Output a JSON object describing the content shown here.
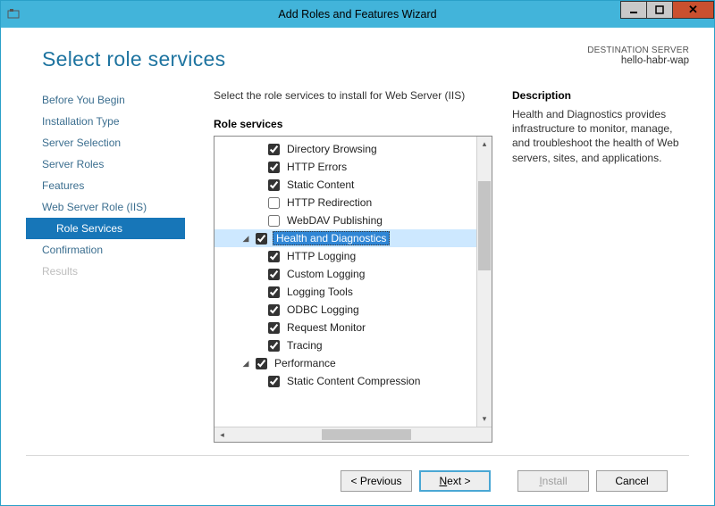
{
  "titlebar": {
    "title": "Add Roles and Features Wizard"
  },
  "page": {
    "heading": "Select role services",
    "destination_label": "DESTINATION SERVER",
    "destination_host": "hello-habr-wap",
    "instruction": "Select the role services to install for Web Server (IIS)",
    "group_label": "Role services"
  },
  "nav": {
    "items": [
      {
        "label": "Before You Begin"
      },
      {
        "label": "Installation Type"
      },
      {
        "label": "Server Selection"
      },
      {
        "label": "Server Roles"
      },
      {
        "label": "Features"
      },
      {
        "label": "Web Server Role (IIS)"
      },
      {
        "label": "Role Services",
        "sub": true,
        "active": true
      },
      {
        "label": "Confirmation"
      },
      {
        "label": "Results",
        "disabled": true
      }
    ]
  },
  "tree": [
    {
      "level": 2,
      "checked": true,
      "label": "Directory Browsing"
    },
    {
      "level": 2,
      "checked": true,
      "label": "HTTP Errors"
    },
    {
      "level": 2,
      "checked": true,
      "label": "Static Content"
    },
    {
      "level": 2,
      "checked": false,
      "label": "HTTP Redirection"
    },
    {
      "level": 2,
      "checked": false,
      "label": "WebDAV Publishing"
    },
    {
      "level": 1,
      "checked": true,
      "label": "Health and Diagnostics",
      "expanded": true,
      "selected": true
    },
    {
      "level": 2,
      "checked": true,
      "label": "HTTP Logging"
    },
    {
      "level": 2,
      "checked": true,
      "label": "Custom Logging"
    },
    {
      "level": 2,
      "checked": true,
      "label": "Logging Tools"
    },
    {
      "level": 2,
      "checked": true,
      "label": "ODBC Logging"
    },
    {
      "level": 2,
      "checked": true,
      "label": "Request Monitor"
    },
    {
      "level": 2,
      "checked": true,
      "label": "Tracing"
    },
    {
      "level": 1,
      "checked": true,
      "label": "Performance",
      "expanded": true
    },
    {
      "level": 2,
      "checked": true,
      "label": "Static Content Compression"
    }
  ],
  "description": {
    "label": "Description",
    "text": "Health and Diagnostics provides infrastructure to monitor, manage, and troubleshoot the health of Web servers, sites, and applications."
  },
  "footer": {
    "previous": "< Previous",
    "next_pre": "N",
    "next_post": "ext >",
    "install_pre": "I",
    "install_post": "nstall",
    "cancel": "Cancel"
  }
}
